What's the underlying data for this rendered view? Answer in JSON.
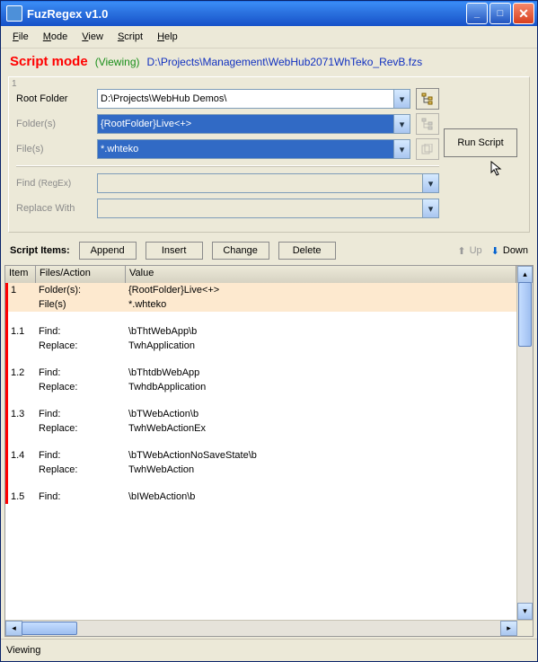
{
  "title": "FuzRegex v1.0",
  "menu": {
    "file": "File",
    "mode": "Mode",
    "view": "View",
    "script": "Script",
    "help": "Help"
  },
  "modebar": {
    "mode": "Script mode",
    "viewing": "(Viewing)",
    "path": "D:\\Projects\\Management\\WebHub2071WhTeko_RevB.fzs"
  },
  "fields": {
    "step": "1",
    "root_lbl": "Root Folder",
    "root_val": "D:\\Projects\\WebHub Demos\\",
    "folders_lbl": "Folder(s)",
    "folders_val": "{RootFolder}Live<+>",
    "files_lbl": "File(s)",
    "files_val": "*.whteko",
    "find_lbl": "Find",
    "find_hint": "(RegEx)",
    "find_val": "",
    "replace_lbl": "Replace With",
    "replace_val": ""
  },
  "run": "Run Script",
  "toolbar": {
    "lbl": "Script Items:",
    "append": "Append",
    "insert": "Insert",
    "change": "Change",
    "delete": "Delete",
    "up": "Up",
    "down": "Down"
  },
  "grid": {
    "h0": "Item",
    "h1": "Files/Action",
    "h2": "Value",
    "rows": [
      {
        "i": "1",
        "a": "Folder(s):",
        "v": "{RootFolder}Live<+>",
        "sel": true
      },
      {
        "i": "",
        "a": "File(s)",
        "v": "*.whteko",
        "sel": true
      },
      {
        "blank": true
      },
      {
        "i": "1.1",
        "a": "Find:",
        "v": "\\bThtWebApp\\b"
      },
      {
        "i": "",
        "a": "Replace:",
        "v": "TwhApplication"
      },
      {
        "blank": true
      },
      {
        "i": "1.2",
        "a": "Find:",
        "v": "\\bThtdbWebApp"
      },
      {
        "i": "",
        "a": "Replace:",
        "v": "TwhdbApplication"
      },
      {
        "blank": true
      },
      {
        "i": "1.3",
        "a": "Find:",
        "v": "\\bTWebAction\\b"
      },
      {
        "i": "",
        "a": "Replace:",
        "v": "TwhWebActionEx"
      },
      {
        "blank": true
      },
      {
        "i": "1.4",
        "a": "Find:",
        "v": "\\bTWebActionNoSaveState\\b"
      },
      {
        "i": "",
        "a": "Replace:",
        "v": "TwhWebAction"
      },
      {
        "blank": true
      },
      {
        "i": "1.5",
        "a": "Find:",
        "v": "\\bIWebAction\\b"
      }
    ]
  },
  "status": "Viewing"
}
